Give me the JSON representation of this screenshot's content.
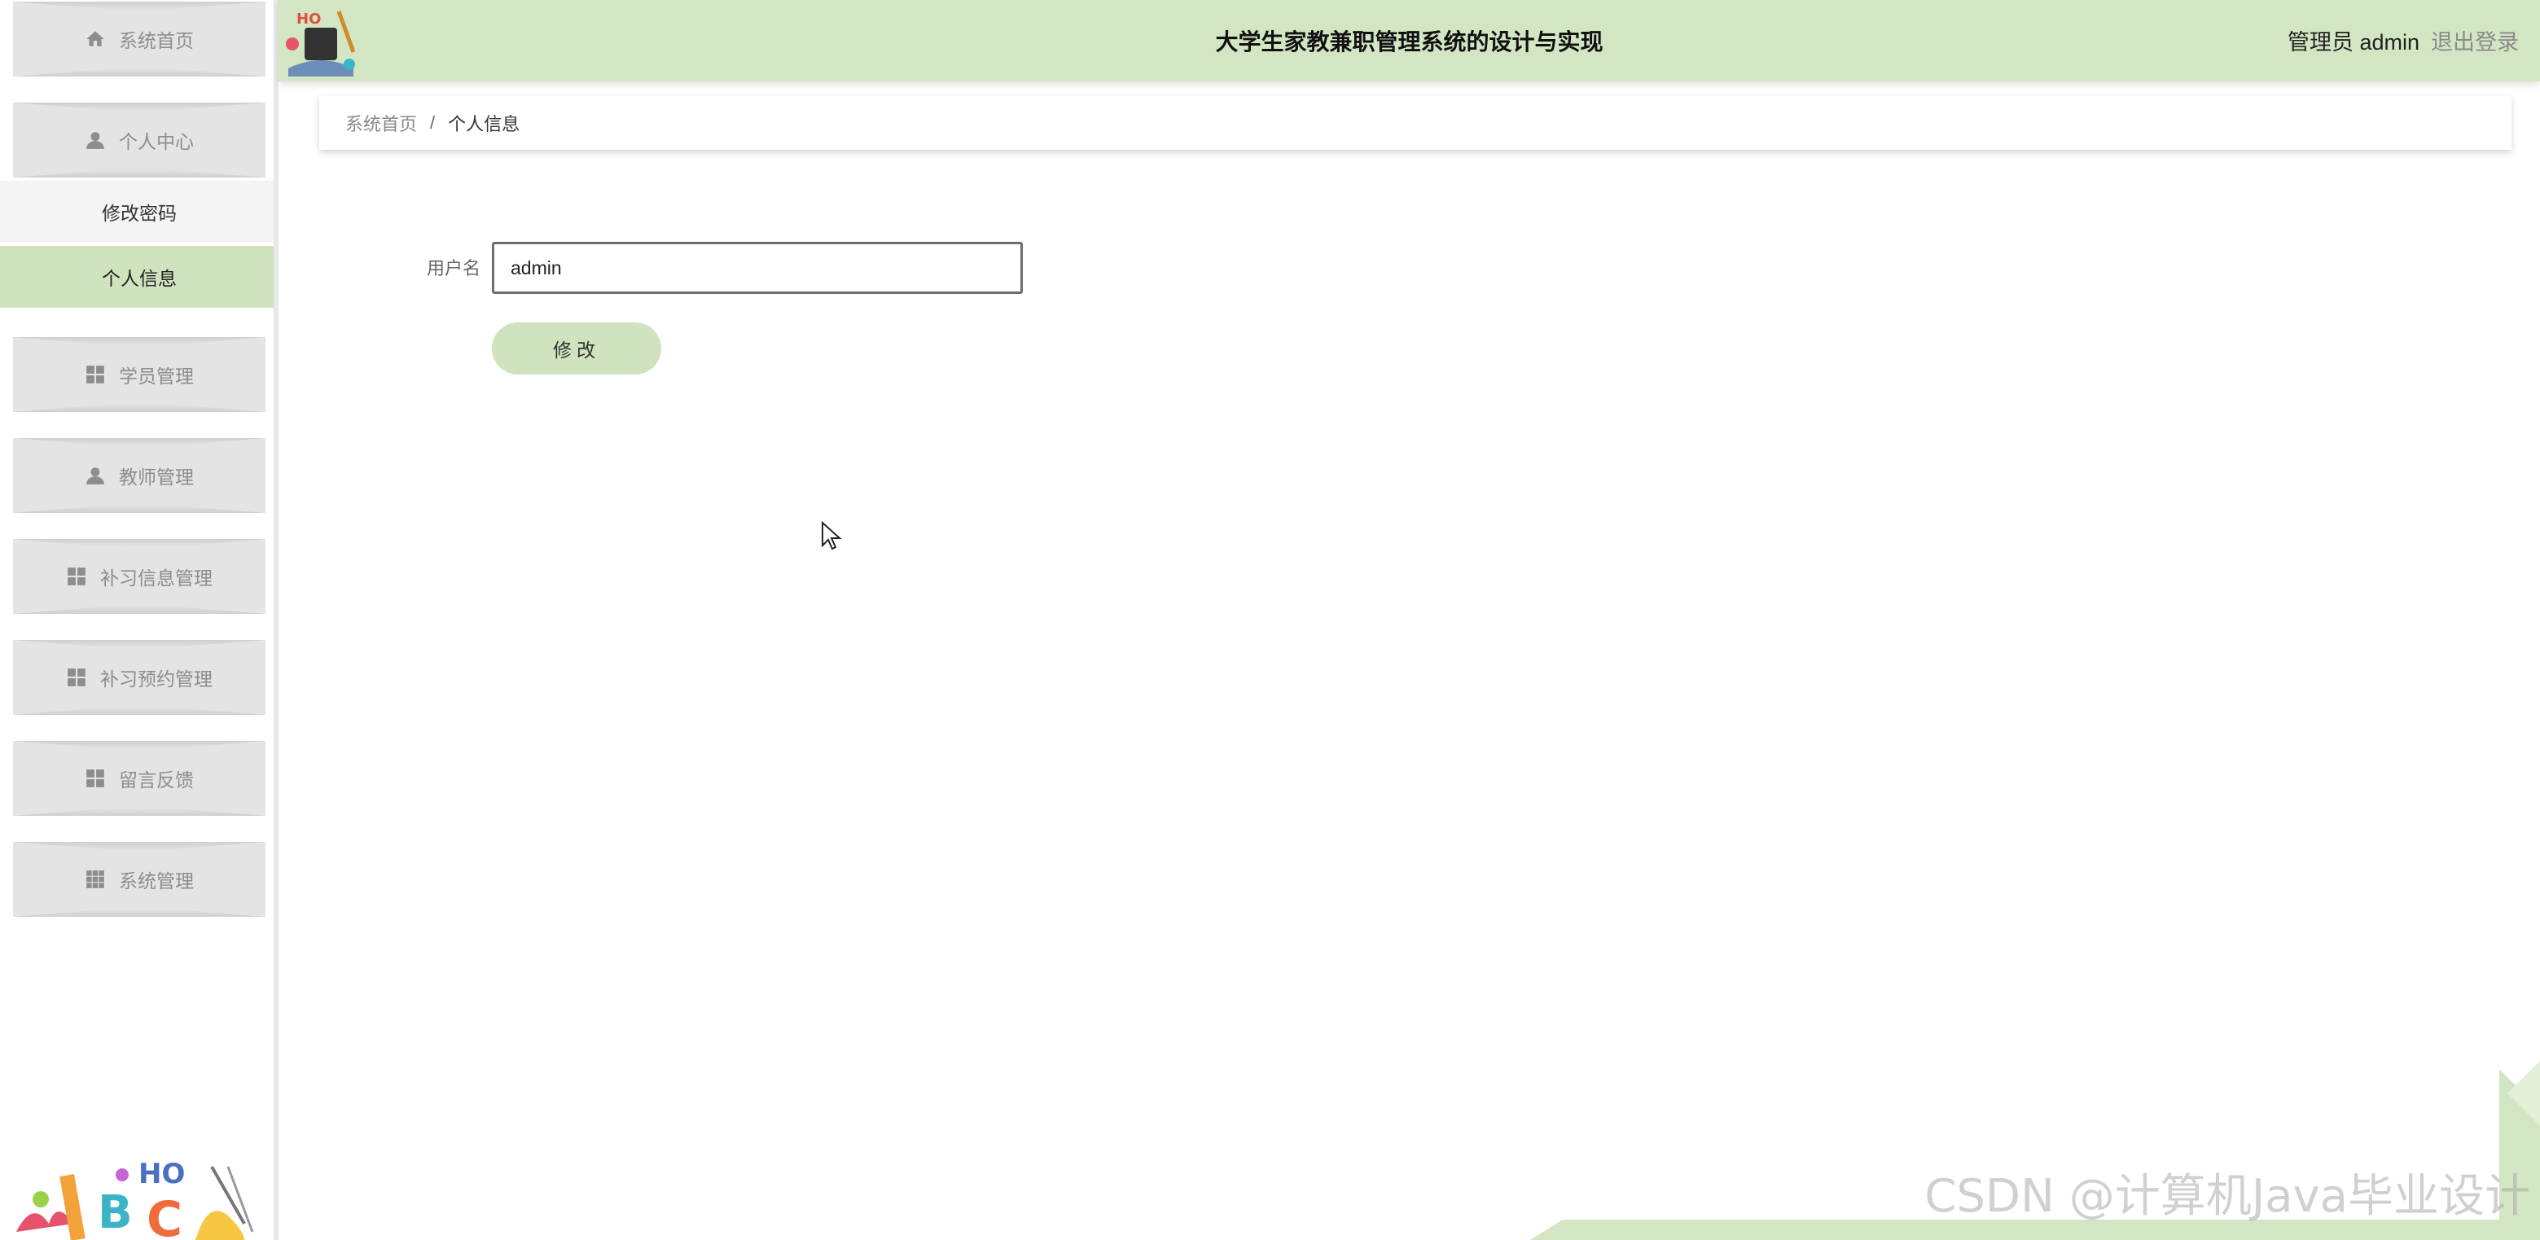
{
  "header": {
    "title": "大学生家教兼职管理系统的设计与实现",
    "user_info": "管理员 admin",
    "logout": "退出登录"
  },
  "sidebar": {
    "items": [
      {
        "label": "系统首页",
        "icon": "home-icon"
      },
      {
        "label": "个人中心",
        "icon": "user-icon"
      },
      {
        "label": "学员管理",
        "icon": "grid-icon"
      },
      {
        "label": "教师管理",
        "icon": "user-icon"
      },
      {
        "label": "补习信息管理",
        "icon": "grid-icon"
      },
      {
        "label": "补习预约管理",
        "icon": "grid-icon"
      },
      {
        "label": "留言反馈",
        "icon": "grid-icon"
      },
      {
        "label": "系统管理",
        "icon": "apps-icon"
      }
    ],
    "subitems": [
      {
        "label": "修改密码"
      },
      {
        "label": "个人信息",
        "active": true
      }
    ]
  },
  "breadcrumb": {
    "home": "系统首页",
    "separator": "/",
    "current": "个人信息"
  },
  "form": {
    "username_label": "用户名",
    "username_value": "admin",
    "submit_label": "修改"
  },
  "watermark": "CSDN @计算机Java毕业设计",
  "colors": {
    "accent": "#d3e6c3",
    "active_item": "#cfe3be",
    "menu_bg": "#e4e4e4"
  }
}
